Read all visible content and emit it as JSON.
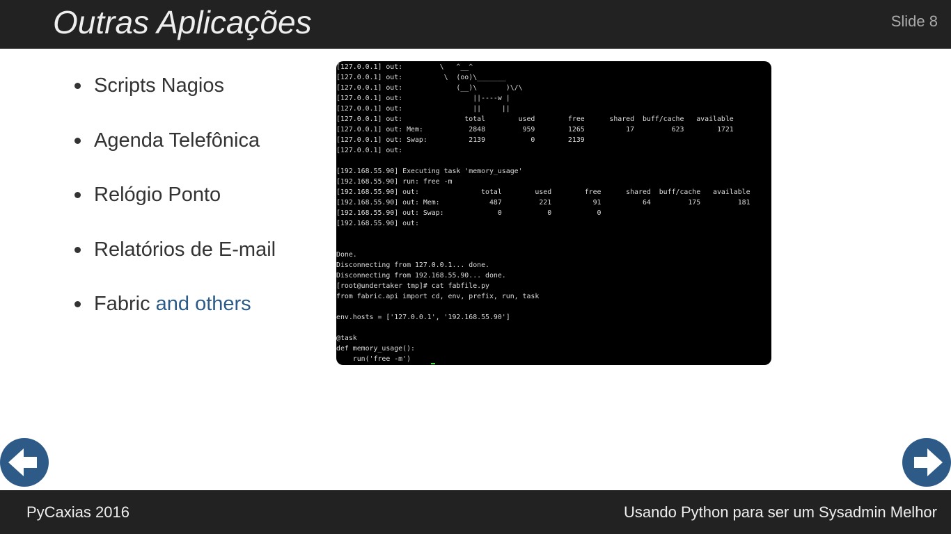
{
  "header": {
    "title": "Outras Aplicações",
    "slide_number": "Slide 8"
  },
  "bullets": [
    {
      "text": "Scripts Nagios"
    },
    {
      "text": "Agenda Telefônica"
    },
    {
      "text": "Relógio Ponto"
    },
    {
      "text": "Relatórios de E-mail"
    },
    {
      "text": "Fabric ",
      "link": "and others"
    }
  ],
  "terminal": {
    "lines": [
      "[127.0.0.1] out:         \\   ^__^",
      "[127.0.0.1] out:          \\  (oo)\\_______",
      "[127.0.0.1] out:             (__)\\       )\\/\\",
      "[127.0.0.1] out:                 ||----w |",
      "[127.0.0.1] out:                 ||     ||",
      "[127.0.0.1] out:               total        used        free      shared  buff/cache   available",
      "[127.0.0.1] out: Mem:           2848         959        1265          17         623        1721",
      "[127.0.0.1] out: Swap:          2139           0        2139",
      "[127.0.0.1] out:",
      "",
      "[192.168.55.90] Executing task 'memory_usage'",
      "[192.168.55.90] run: free -m",
      "[192.168.55.90] out:               total        used        free      shared  buff/cache   available",
      "[192.168.55.90] out: Mem:            487         221          91          64         175         181",
      "[192.168.55.90] out: Swap:             0           0           0",
      "[192.168.55.90] out:",
      "",
      "",
      "Done.",
      "Disconnecting from 127.0.0.1... done.",
      "Disconnecting from 192.168.55.90... done.",
      "[root@undertaker tmp]# cat fabfile.py",
      "from fabric.api import cd, env, prefix, run, task",
      "",
      "env.hosts = ['127.0.0.1', '192.168.55.90']",
      "",
      "@task",
      "def memory_usage():",
      "    run('free -m')"
    ]
  },
  "navigation": {
    "prev_icon": "arrow-left-icon",
    "next_icon": "arrow-right-icon",
    "button_color": "#2e5a87"
  },
  "footer": {
    "left": "PyCaxias 2016",
    "right": "Usando Python para ser um Sysadmin Melhor"
  },
  "colors": {
    "header_bg": "#222222",
    "link": "#2c5a86",
    "text": "#333333"
  }
}
